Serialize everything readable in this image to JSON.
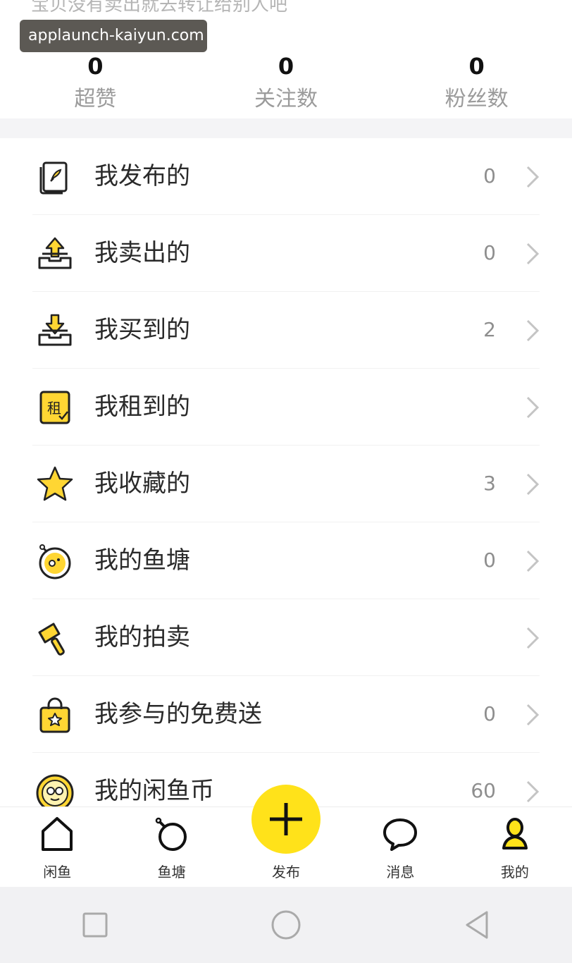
{
  "watermark": "applaunch-kaiyun.com",
  "top_cut_text": "宝贝没有卖出就去转让给别人吧",
  "stats": [
    {
      "value": "0",
      "label": "超赞"
    },
    {
      "value": "0",
      "label": "关注数"
    },
    {
      "value": "0",
      "label": "粉丝数"
    }
  ],
  "menu": [
    {
      "label": "我发布的",
      "count": "0",
      "icon": "document-icon"
    },
    {
      "label": "我卖出的",
      "count": "0",
      "icon": "upload-tray-icon"
    },
    {
      "label": "我买到的",
      "count": "2",
      "icon": "download-tray-icon"
    },
    {
      "label": "我租到的",
      "count": "",
      "icon": "rent-icon",
      "icon_text": "租"
    },
    {
      "label": "我收藏的",
      "count": "3",
      "icon": "star-icon"
    },
    {
      "label": "我的鱼塘",
      "count": "0",
      "icon": "fishpond-icon"
    },
    {
      "label": "我的拍卖",
      "count": "",
      "icon": "auction-hammer-icon"
    },
    {
      "label": "我参与的免费送",
      "count": "0",
      "icon": "gift-bag-icon"
    },
    {
      "label": "我的闲鱼币",
      "count": "60",
      "icon": "coin-icon"
    }
  ],
  "tabs": [
    {
      "label": "闲鱼",
      "icon": "home-icon"
    },
    {
      "label": "鱼塘",
      "icon": "pond-ring-icon"
    },
    {
      "label": "发布",
      "icon": "plus-icon"
    },
    {
      "label": "消息",
      "icon": "chat-bubble-icon"
    },
    {
      "label": "我的",
      "icon": "profile-icon"
    }
  ],
  "colors": {
    "accent_yellow": "#ffe21a",
    "icon_yellow": "#ffd633",
    "text_dark": "#2a2a2a",
    "text_gray": "#8e8e8e",
    "bg_gray": "#f4f4f6"
  }
}
